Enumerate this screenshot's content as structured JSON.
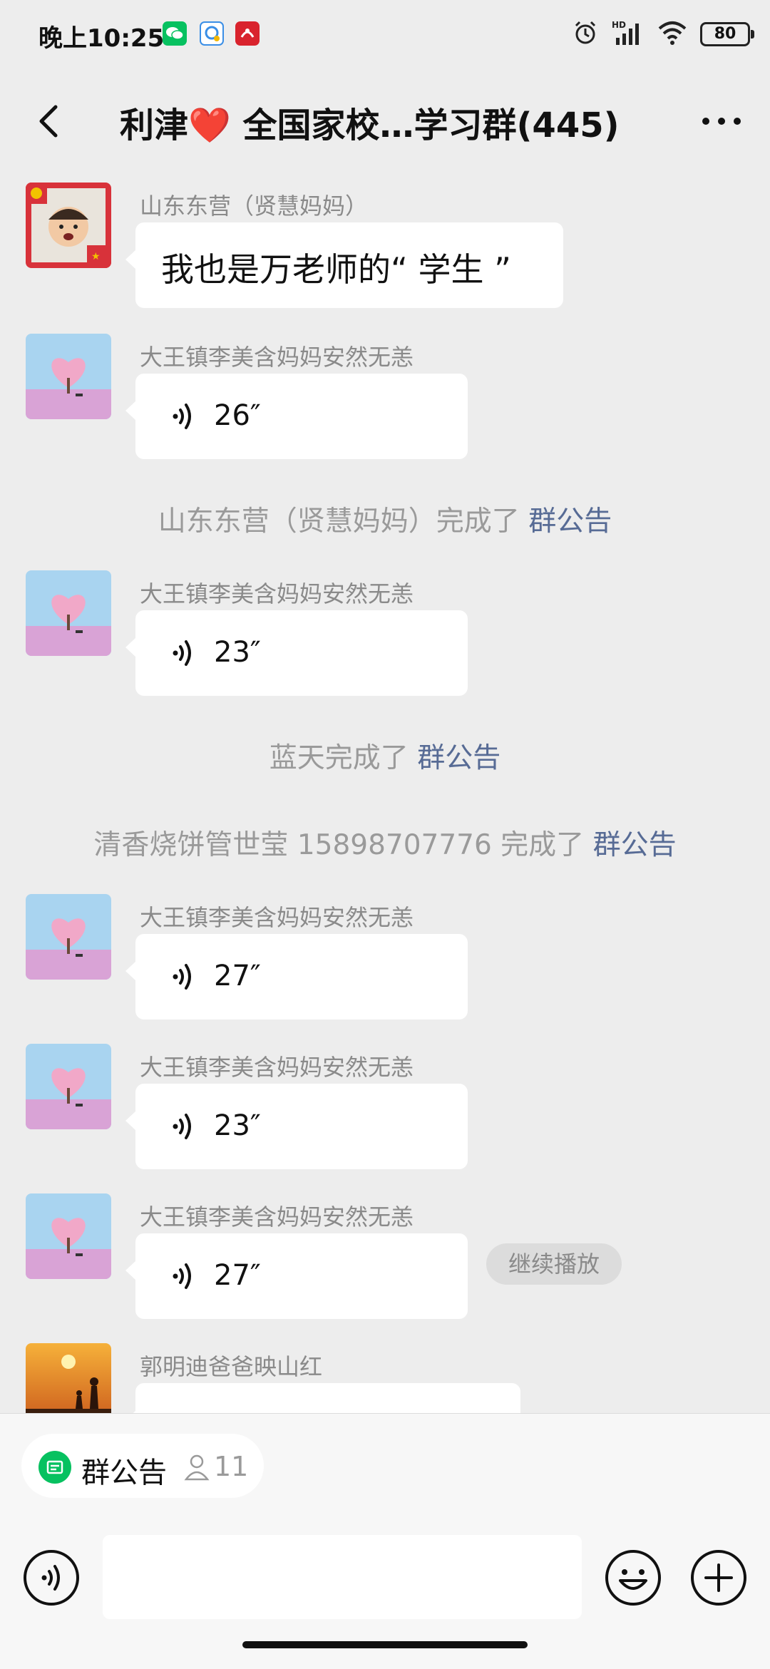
{
  "status_bar": {
    "time": "晚上10:25",
    "battery": "80"
  },
  "nav": {
    "title_prefix": "利津",
    "heart": "❤️",
    "title_suffix": " 全国家校…学习群(445)"
  },
  "messages": [
    {
      "sender": "山东东营（贤慧妈妈）",
      "text": "我也是万老师的“ 学生 ”"
    },
    {
      "sender": "大王镇李美含妈妈安然无恙",
      "duration": "26″"
    },
    {
      "sender": "大王镇李美含妈妈安然无恙",
      "duration": "23″"
    },
    {
      "sender": "大王镇李美含妈妈安然无恙",
      "duration": "27″"
    },
    {
      "sender": "大王镇李美含妈妈安然无恙",
      "duration": "23″"
    },
    {
      "sender": "大王镇李美含妈妈安然无恙",
      "duration": "27″"
    },
    {
      "sender": "郭明迪爸爸映山红"
    }
  ],
  "system_notices": [
    {
      "text": "山东东营（贤慧妈妈）完成了 ",
      "link": "群公告"
    },
    {
      "text": "蓝天完成了 ",
      "link": "群公告"
    },
    {
      "text": "清香烧饼管世莹 15898707776 完成了 ",
      "link": "群公告"
    }
  ],
  "continue_play": "继续播放",
  "bottom": {
    "notice_label": "群公告",
    "notice_count": "11"
  },
  "colors": {
    "background": "#ededed",
    "link": "#576b95",
    "accent_green": "#07c160",
    "heart": "#e0243a"
  }
}
